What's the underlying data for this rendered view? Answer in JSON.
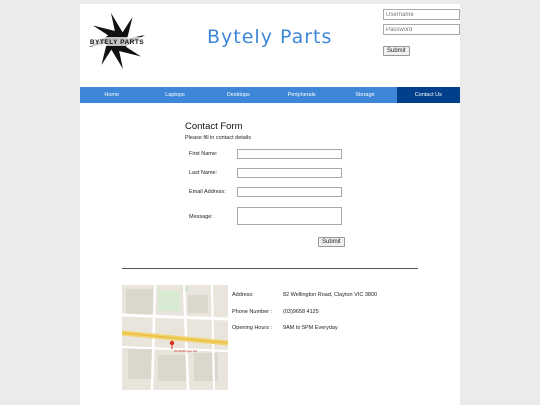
{
  "header": {
    "logo_text": "BYTELY PARTS",
    "site_title": "Bytely Parts"
  },
  "login": {
    "username_placeholder": "Username",
    "password_placeholder": "Password",
    "submit_label": "Submit"
  },
  "nav": {
    "items": [
      "Home",
      "Laptops",
      "Desktops",
      "Peripherals",
      "Storage",
      "Contact Us"
    ],
    "active": "Contact Us"
  },
  "contact_form": {
    "title": "Contact Form",
    "subtitle": "Please fill in contact details",
    "first_name_label": "First Name:",
    "last_name_label": "Last Name:",
    "email_label": "Email Address:",
    "message_label": "Message:",
    "submit_label": "Submit"
  },
  "map": {
    "pin_label": "82 Wellington Rd"
  },
  "info": {
    "address_label": "Address:",
    "address_value": "82 Wellington Road, Clayton VIC 3800",
    "phone_label": "Phone Number :",
    "phone_value": "(03)9658 4125",
    "hours_label": "Opening Hours :",
    "hours_value": "9AM to 5PM Everyday"
  },
  "colors": {
    "accent": "#3d86d8",
    "nav_active": "#003f8a",
    "page_bg": "#ebebeb"
  }
}
